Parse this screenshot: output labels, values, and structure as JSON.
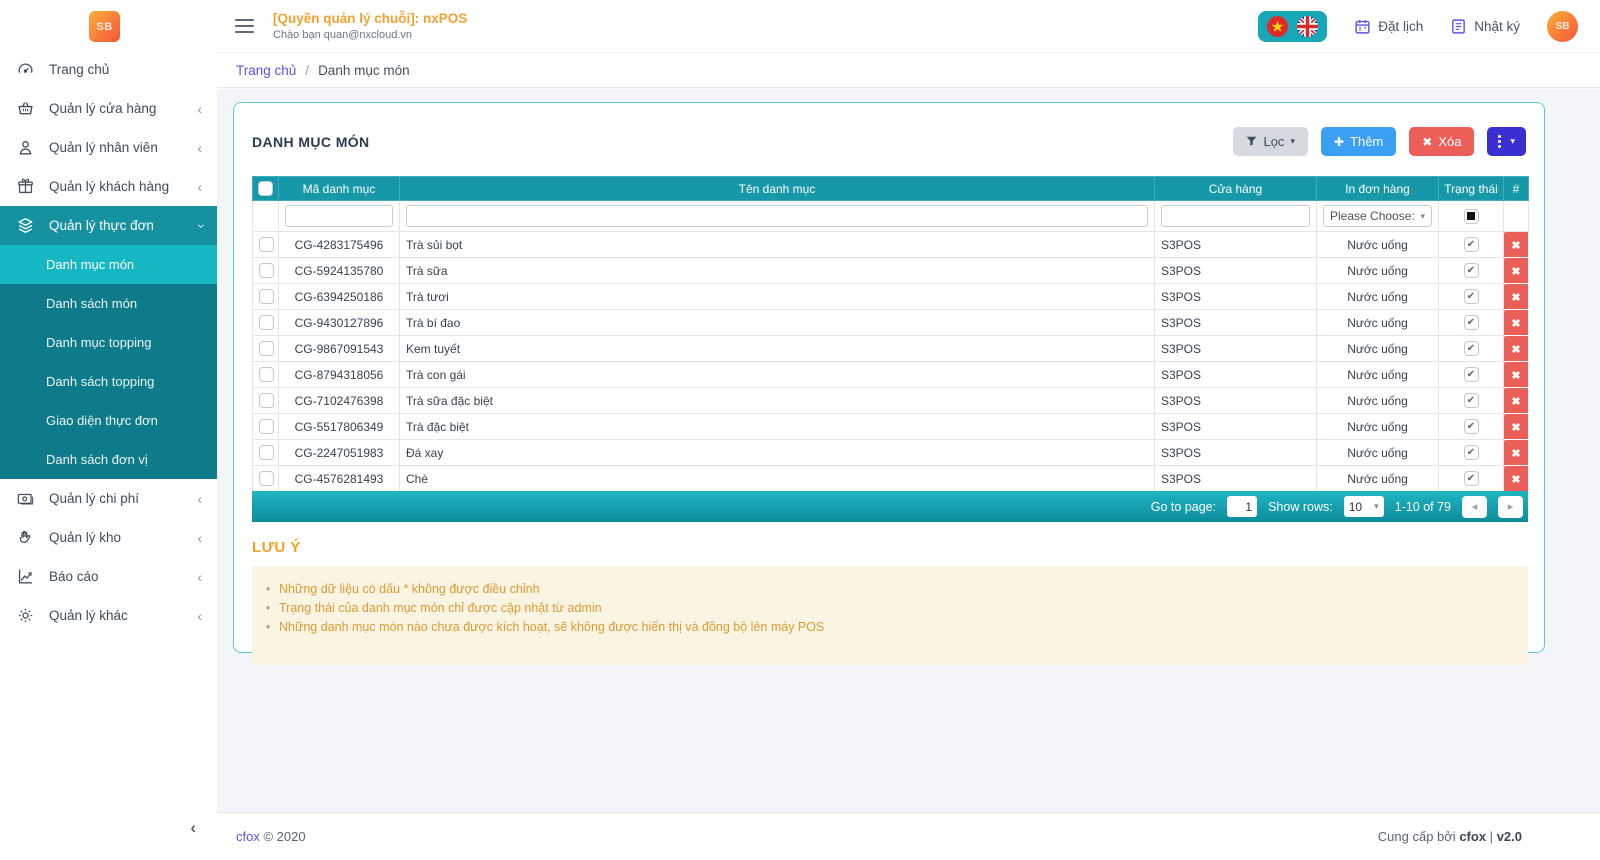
{
  "app": {
    "logo_text": "SB",
    "title": "[Quyền quản lý chuỗi]: nxPOS",
    "greeting": "Chào bạn quan@nxcloud.vn"
  },
  "topbar": {
    "schedule_label": "Đặt lịch",
    "journal_label": "Nhật ký",
    "flags": [
      "vietnam-flag",
      "uk-flag"
    ]
  },
  "breadcrumb": {
    "home": "Trang chủ",
    "separator": "/",
    "current": "Danh mục món"
  },
  "sidebar": {
    "items": [
      {
        "id": "home",
        "label": "Trang chủ",
        "icon": "dashboard",
        "chevron": null,
        "active": false
      },
      {
        "id": "stores",
        "label": "Quản lý cửa hàng",
        "icon": "store",
        "chevron": "collapsed",
        "active": false
      },
      {
        "id": "staff",
        "label": "Quản lý nhân viên",
        "icon": "staff",
        "chevron": "collapsed",
        "active": false
      },
      {
        "id": "customers",
        "label": "Quản lý khách hàng",
        "icon": "customers",
        "chevron": "collapsed",
        "active": false
      },
      {
        "id": "menu",
        "label": "Quản lý thực đơn",
        "icon": "menu",
        "chevron": "expanded",
        "active": true,
        "children": [
          "Danh mục món",
          "Danh sách món",
          "Danh mục topping",
          "Danh sách topping",
          "Giao diện thực đơn",
          "Danh sách đơn vị"
        ],
        "active_child": "Danh mục món"
      },
      {
        "id": "expense",
        "label": "Quản lý chi phí",
        "icon": "expense",
        "chevron": "collapsed",
        "active": false
      },
      {
        "id": "warehouse",
        "label": "Quản lý kho",
        "icon": "warehouse",
        "chevron": "collapsed",
        "active": false
      },
      {
        "id": "report",
        "label": "Báo cáo",
        "icon": "report",
        "chevron": "collapsed",
        "active": false
      },
      {
        "id": "other",
        "label": "Quản lý khác",
        "icon": "other",
        "chevron": "collapsed",
        "active": false
      }
    ]
  },
  "panel": {
    "title": "DANH MỤC MÓN",
    "buttons": {
      "filter": "Lọc",
      "add": "Thêm",
      "delete": "Xóa"
    }
  },
  "table": {
    "headers": [
      "Mã danh mục",
      "Tên danh mục",
      "Cửa hàng",
      "In đơn hàng",
      "Trạng thái",
      "#"
    ],
    "filter_select_placeholder": "Please Choose:",
    "rows": [
      {
        "code": "CG-4283175496",
        "name": "Trà sủi bọt",
        "store": "S3POS",
        "print": "Nước uống",
        "status": true
      },
      {
        "code": "CG-5924135780",
        "name": "Trà sữa",
        "store": "S3POS",
        "print": "Nước uống",
        "status": true
      },
      {
        "code": "CG-6394250186",
        "name": "Trà tươi",
        "store": "S3POS",
        "print": "Nước uống",
        "status": true
      },
      {
        "code": "CG-9430127896",
        "name": "Trà bí đao",
        "store": "S3POS",
        "print": "Nước uống",
        "status": true
      },
      {
        "code": "CG-9867091543",
        "name": "Kem tuyết",
        "store": "S3POS",
        "print": "Nước uống",
        "status": true
      },
      {
        "code": "CG-8794318056",
        "name": "Trà con gái",
        "store": "S3POS",
        "print": "Nước uống",
        "status": true
      },
      {
        "code": "CG-7102476398",
        "name": "Trà sữa đặc biệt",
        "store": "S3POS",
        "print": "Nước uống",
        "status": true
      },
      {
        "code": "CG-5517806349",
        "name": "Trà đặc biệt",
        "store": "S3POS",
        "print": "Nước uống",
        "status": true
      },
      {
        "code": "CG-2247051983",
        "name": "Đá xay",
        "store": "S3POS",
        "print": "Nước uống",
        "status": true
      },
      {
        "code": "CG-4576281493",
        "name": "Chè",
        "store": "S3POS",
        "print": "Nước uống",
        "status": true
      }
    ]
  },
  "pagination": {
    "goto_label": "Go to page:",
    "page_value": "1",
    "show_rows_label": "Show rows:",
    "rows_per_page": "10",
    "range_text": "1-10 of 79"
  },
  "notes": {
    "title": "LƯU Ý",
    "items": [
      "Những dữ liệu có dấu * không được điều chỉnh",
      "Trạng thái của danh mục món chỉ được cập nhật từ admin",
      "Những danh mục món nào chưa được kích hoạt, sẽ không được hiển thị và đồng bộ lên máy POS"
    ]
  },
  "footer": {
    "left_link": "cfox",
    "left_rest": "© 2020",
    "right_prefix": "Cung cấp bởi",
    "right_brand": "cfox",
    "right_sep": "|",
    "right_version": "v2.0"
  },
  "colors": {
    "teal_header": "#1698a8",
    "teal_submenu": "#0d7b8a",
    "teal_active_sub": "#16b6c2",
    "teal_active_parent": "#15919f",
    "card_border": "#58cdd9",
    "orange_accent": "#f2a232",
    "note_text": "#df9a33",
    "note_bg": "#faf4e3",
    "link_purple": "#5a54e8",
    "btn_blue": "#3b9ff3",
    "btn_red": "#ec5f59",
    "btn_indigo": "#3a2fd1"
  }
}
